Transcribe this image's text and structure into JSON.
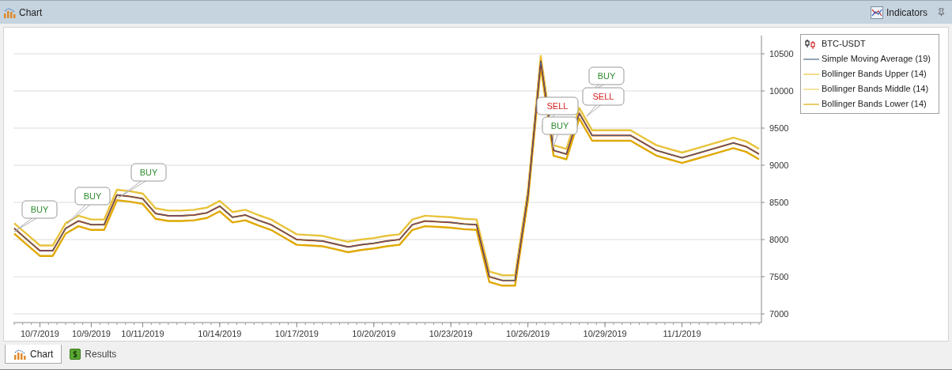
{
  "header": {
    "title": "Chart",
    "indicators_button": "Indicators"
  },
  "chart_data": {
    "type": "line",
    "categories": [
      null,
      null,
      "10/7/2019",
      null,
      null,
      null,
      "10/9/2019",
      null,
      null,
      null,
      "10/11/2019",
      null,
      null,
      null,
      null,
      null,
      "10/14/2019",
      null,
      null,
      null,
      null,
      null,
      "10/17/2019",
      null,
      null,
      null,
      null,
      null,
      "10/20/2019",
      null,
      null,
      null,
      null,
      null,
      "10/23/2019",
      null,
      null,
      null,
      null,
      null,
      "10/26/2019",
      null,
      null,
      null,
      null,
      null,
      "10/29/2019",
      null,
      null,
      null,
      null,
      null,
      "11/1/2019",
      null,
      null,
      null,
      null,
      null,
      null
    ],
    "series": [
      {
        "name": "BTC-USDT",
        "color": "#cc0000",
        "values": [
          8150,
          8000,
          7850,
          7850,
          8150,
          8250,
          8200,
          8200,
          8600,
          8580,
          8550,
          8350,
          8320,
          8320,
          8330,
          8360,
          8450,
          8300,
          8330,
          8260,
          8200,
          8100,
          8000,
          7990,
          7980,
          7940,
          7900,
          7930,
          7950,
          7980,
          8000,
          8200,
          8250,
          8240,
          8230,
          8210,
          8200,
          7500,
          7450,
          7450,
          8600,
          10400,
          9200,
          9150,
          9700,
          9400,
          9400,
          9400,
          9400,
          9300,
          9200,
          9150,
          9100,
          9150,
          9200,
          9250,
          9300,
          9250,
          9150
        ]
      },
      {
        "name": "Simple Moving Average (19)",
        "color": "#4a6580",
        "values": [
          8150,
          8000,
          7850,
          7850,
          8150,
          8250,
          8200,
          8200,
          8600,
          8580,
          8550,
          8350,
          8320,
          8320,
          8330,
          8360,
          8450,
          8300,
          8330,
          8260,
          8200,
          8100,
          8000,
          7990,
          7980,
          7940,
          7900,
          7930,
          7950,
          7980,
          8000,
          8200,
          8250,
          8240,
          8230,
          8210,
          8200,
          7500,
          7450,
          7450,
          8600,
          10400,
          9200,
          9150,
          9700,
          9400,
          9400,
          9400,
          9400,
          9300,
          9200,
          9150,
          9100,
          9150,
          9200,
          9250,
          9300,
          9250,
          9150
        ]
      },
      {
        "name": "Bollinger Bands Upper (14)",
        "color": "#e8c33a",
        "values": [
          8220,
          8070,
          7920,
          7920,
          8220,
          8320,
          8270,
          8270,
          8670,
          8650,
          8620,
          8420,
          8390,
          8390,
          8400,
          8430,
          8520,
          8370,
          8400,
          8330,
          8270,
          8170,
          8070,
          8060,
          8050,
          8010,
          7970,
          8000,
          8020,
          8050,
          8070,
          8270,
          8320,
          8310,
          8300,
          8280,
          8270,
          7570,
          7520,
          7520,
          8670,
          10470,
          9270,
          9220,
          9770,
          9470,
          9470,
          9470,
          9470,
          9370,
          9270,
          9220,
          9170,
          9220,
          9270,
          9320,
          9370,
          9320,
          9220
        ]
      },
      {
        "name": "Bollinger Bands Middle (14)",
        "color": "#f0d060",
        "values": [
          8150,
          8000,
          7850,
          7850,
          8150,
          8250,
          8200,
          8200,
          8600,
          8580,
          8550,
          8350,
          8320,
          8320,
          8330,
          8360,
          8450,
          8300,
          8330,
          8260,
          8200,
          8100,
          8000,
          7990,
          7980,
          7940,
          7900,
          7930,
          7950,
          7980,
          8000,
          8200,
          8250,
          8240,
          8230,
          8210,
          8200,
          7500,
          7450,
          7450,
          8600,
          10400,
          9200,
          9150,
          9700,
          9400,
          9400,
          9400,
          9400,
          9300,
          9200,
          9150,
          9100,
          9150,
          9200,
          9250,
          9300,
          9250,
          9150
        ]
      },
      {
        "name": "Bollinger Bands Lower (14)",
        "color": "#e0a800",
        "values": [
          8080,
          7930,
          7780,
          7780,
          8080,
          8180,
          8130,
          8130,
          8530,
          8510,
          8480,
          8280,
          8250,
          8250,
          8260,
          8290,
          8380,
          8230,
          8260,
          8190,
          8130,
          8030,
          7930,
          7920,
          7910,
          7870,
          7830,
          7860,
          7880,
          7910,
          7930,
          8130,
          8180,
          8170,
          8160,
          8140,
          8130,
          7430,
          7380,
          7380,
          8530,
          10330,
          9130,
          9080,
          9630,
          9330,
          9330,
          9330,
          9330,
          9230,
          9130,
          9080,
          9030,
          9080,
          9130,
          9180,
          9230,
          9180,
          9080
        ]
      }
    ],
    "grid": true,
    "ylim": [
      6883,
      10745
    ],
    "yticks": [
      7000,
      7500,
      8000,
      8500,
      9000,
      9500,
      10000,
      10500
    ]
  },
  "signals": [
    {
      "text": "BUY",
      "color": "#2e8b2e"
    },
    {
      "text": "BUY",
      "color": "#2e8b2e"
    },
    {
      "text": "BUY",
      "color": "#2e8b2e"
    },
    {
      "text": "SELL",
      "color": "#d42020"
    },
    {
      "text": "BUY",
      "color": "#2e8b2e"
    },
    {
      "text": "SELL",
      "color": "#d42020"
    },
    {
      "text": "BUY",
      "color": "#2e8b2e"
    }
  ],
  "tabs": [
    {
      "label": "Chart",
      "selected": true
    },
    {
      "label": "Results",
      "selected": false
    }
  ]
}
